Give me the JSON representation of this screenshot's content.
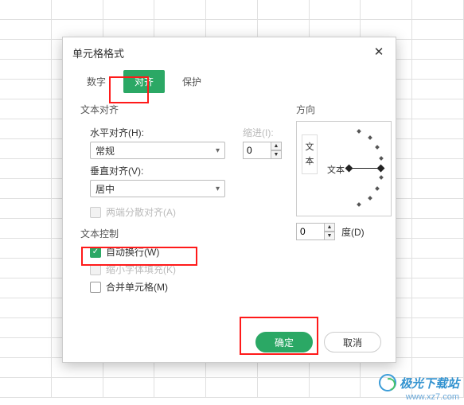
{
  "dialog": {
    "title": "单元格格式",
    "tabs": {
      "number": "数字",
      "align": "对齐",
      "protect": "保护"
    },
    "textAlign": {
      "section": "文本对齐",
      "horizLabel": "水平对齐(H):",
      "horizValue": "常规",
      "indentLabel": "缩进(I):",
      "indentValue": "0",
      "vertLabel": "垂直对齐(V):",
      "vertValue": "居中",
      "justifyDistributed": "两端分散对齐(A)"
    },
    "textControl": {
      "section": "文本控制",
      "wrap": "自动换行(W)",
      "shrink": "缩小字体填充(K)",
      "merge": "合并单元格(M)"
    },
    "orient": {
      "section": "方向",
      "verticalText": "文本",
      "arcLabel": "文本",
      "degreeValue": "0",
      "degreeLabel": "度(D)"
    },
    "buttons": {
      "ok": "确定",
      "cancel": "取消"
    }
  },
  "watermark": {
    "name": "极光下载站",
    "url": "www.xz7.com"
  }
}
